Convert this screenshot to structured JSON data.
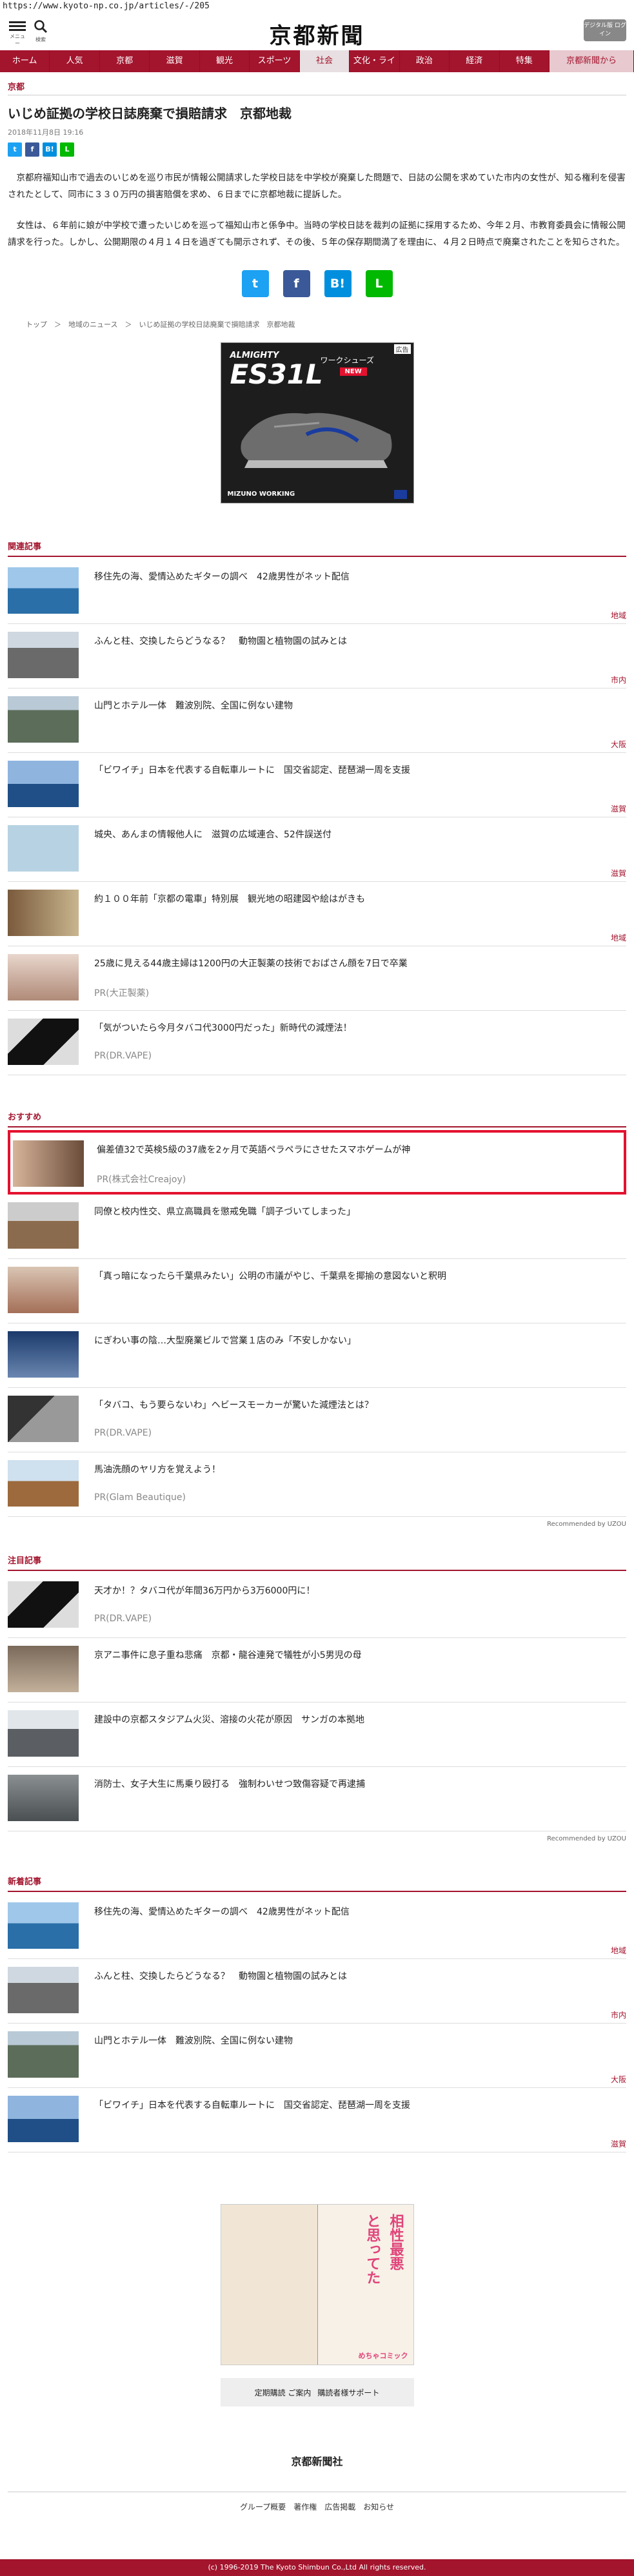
{
  "url": "https://www.kyoto-np.co.jp/articles/-/205",
  "header": {
    "menu_label": "メニュー",
    "search_label": "検索",
    "logo": "京都新聞",
    "edition_btn": "デジタル版 ログイン"
  },
  "nav": [
    "ホーム",
    "人気",
    "京都",
    "滋賀",
    "観光",
    "スポーツ",
    "社会",
    "文化・ライフ",
    "政治",
    "経済",
    "特集",
    "京都新聞から"
  ],
  "article": {
    "category": "京都",
    "title": "いじめ証拠の学校日誌廃棄で損賠請求　京都地裁",
    "date": "2018年11月8日 19:16",
    "p1": "京都府福知山市で過去のいじめを巡り市民が情報公開請求した学校日誌を中学校が廃棄した問題で、日誌の公開を求めていた市内の女性が、知る権利を侵害されたとして、同市に３３０万円の損害賠償を求め、６日までに京都地裁に提訴した。",
    "p2": "女性は、６年前に娘が中学校で遭ったいじめを巡って福知山市と係争中。当時の学校日誌を裁判の証拠に採用するため、今年２月、市教育委員会に情報公開請求を行った。しかし、公開期限の４月１４日を過ぎても開示されず、その後、５年の保存期間満了を理由に、４月２日時点で廃棄されたことを知らされた。",
    "breadcrumb": "トップ　＞　地域のニュース　＞　いじめ証拠の学校日誌廃棄で損賠請求　京都地裁"
  },
  "ad1": {
    "brand": "ALMIGHTY",
    "model": "ES31L",
    "new": "NEW",
    "tag": "ワークシューズ",
    "maker": "MIZUNO WORKING",
    "adlabel": "広告"
  },
  "related": {
    "heading": "関連記事",
    "items": [
      {
        "title": "移住先の海、愛情込めたギターの調べ　42歳男性がネット配信",
        "tag": "地域"
      },
      {
        "title": "ふんと柱、交換したらどうなる？　動物園と植物園の試みとは",
        "tag": "市内"
      },
      {
        "title": "山門とホテル一体　難波別院、全国に例ない建物",
        "tag": "大阪"
      },
      {
        "title": "「ビワイチ」日本を代表する自転車ルートに　国交省認定、琵琶湖一周を支援",
        "tag": "滋賀"
      },
      {
        "title": "城央、あんまの情報他人に　滋賀の広域連合、52件誤送付",
        "tag": "滋賀"
      },
      {
        "title": "約１００年前「京都の電車」特別展　観光地の昭建図や絵はがきも",
        "tag": "地域"
      },
      {
        "title": "25歳に見える44歳主婦は1200円の大正製薬の技術でおばさん顔を7日で卒業",
        "pr": "PR(大正製薬)"
      },
      {
        "title": "「気がついたら今月タバコ代3000円だった」新時代の減煙法！",
        "pr": "PR(DR.VAPE)"
      }
    ]
  },
  "recommend": {
    "heading": "おすすめ",
    "credit": "Recommended by UZOU",
    "items": [
      {
        "title": "偏差値32で英検5級の37歳を2ヶ月で英語ペラペラにさせたスマホゲームが神",
        "pr": "PR(株式会社Creajoy)"
      },
      {
        "title": "同僚と校内性交、県立高職員を懲戒免職「調子づいてしまった」"
      },
      {
        "title": "「真っ暗になったら千葉県みたい」公明の市議がやじ、千葉県を揶揄の意図ないと釈明"
      },
      {
        "title": "にぎわい事の陰…大型廃業ビルで営業１店のみ「不安しかない」"
      },
      {
        "title": "「タバコ、もう要らないわ」ヘビースモーカーが驚いた減煙法とは？",
        "pr": "PR(DR.VAPE)"
      },
      {
        "title": "馬油洗顔のヤリ方を覚えよう！",
        "pr": "PR(Glam Beautique)"
      }
    ]
  },
  "attention": {
    "heading": "注目記事",
    "credit": "Recommended by UZOU",
    "items": [
      {
        "title": "天才か！？タバコ代が年間36万円から3万6000円に！",
        "pr": "PR(DR.VAPE)"
      },
      {
        "title": "京アニ事件に息子重ね悲痛　京都・龍谷連発で犠牲が小5男児の母"
      },
      {
        "title": "建設中の京都スタジアム火災、溶接の火花が原因　サンガの本拠地"
      },
      {
        "title": "消防士、女子大生に馬乗り殴打る　強制わいせつ致傷容疑で再逮捕"
      }
    ]
  },
  "latest": {
    "heading": "新着記事",
    "items": [
      {
        "title": "移住先の海、愛情込めたギターの調べ　42歳男性がネット配信",
        "tag": "地域"
      },
      {
        "title": "ふんと柱、交換したらどうなる？　動物園と植物園の試みとは",
        "tag": "市内"
      },
      {
        "title": "山門とホテル一体　難波別院、全国に例ない建物",
        "tag": "大阪"
      },
      {
        "title": "「ビワイチ」日本を代表する自転車ルートに　国交省認定、琵琶湖一周を支援",
        "tag": "滋賀"
      }
    ]
  },
  "ad2": {
    "headline1": "相性最悪",
    "headline2": "と思ってた",
    "tag": "めちゃコミック"
  },
  "footer": {
    "btn1": "定期購読 ご案内",
    "btn2": "購読者様サポート",
    "logo": "京都新聞社",
    "links": "グループ概要　著作権　広告掲載　お知らせ",
    "copyright": "(c) 1996-2019 The Kyoto Shimbun Co.,Ltd All rights reserved."
  }
}
